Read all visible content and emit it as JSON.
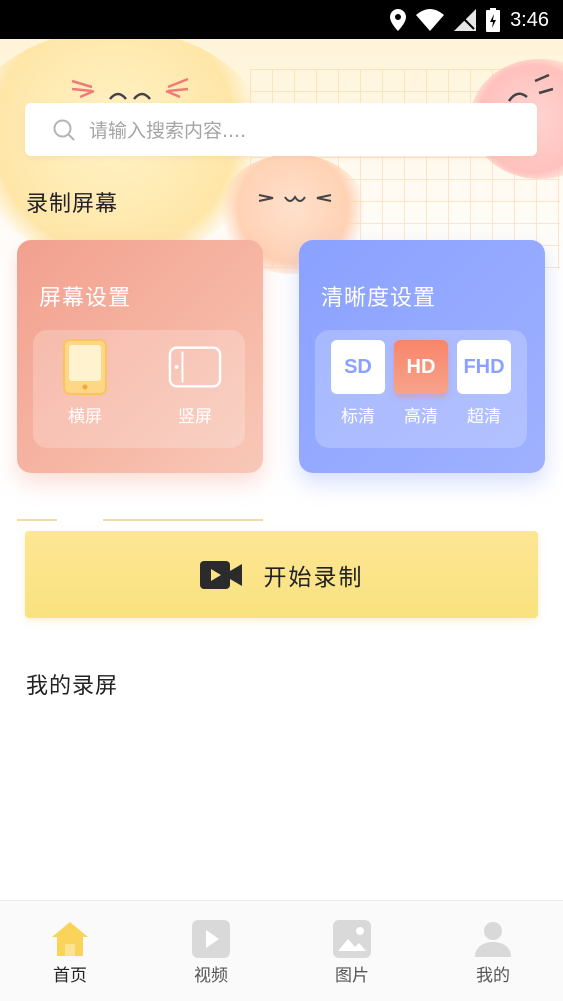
{
  "status": {
    "time": "3:46"
  },
  "search": {
    "placeholder": "请输入搜索内容...."
  },
  "sections": {
    "record": "录制屏幕",
    "my_recordings": "我的录屏"
  },
  "screen_card": {
    "title": "屏幕设置",
    "options": [
      {
        "label": "横屏",
        "icon": "phone-portrait-icon",
        "selected": true
      },
      {
        "label": "竖屏",
        "icon": "phone-landscape-icon",
        "selected": false
      }
    ]
  },
  "quality_card": {
    "title": "清晰度设置",
    "options": [
      {
        "badge": "SD",
        "label": "标清",
        "selected": false
      },
      {
        "badge": "HD",
        "label": "高清",
        "selected": true
      },
      {
        "badge": "FHD",
        "label": "超清",
        "selected": false
      }
    ]
  },
  "record_button": {
    "label": "开始录制",
    "icon": "video-camera-icon"
  },
  "nav": [
    {
      "label": "首页",
      "icon": "home-icon",
      "active": true
    },
    {
      "label": "视频",
      "icon": "video-icon",
      "active": false
    },
    {
      "label": "图片",
      "icon": "image-icon",
      "active": false
    },
    {
      "label": "我的",
      "icon": "user-icon",
      "active": false
    }
  ],
  "colors": {
    "accent_yellow": "#fae383",
    "card_screen": "#f2a08e",
    "card_quality": "#8aa1ff",
    "hd_active": "#f8856a"
  }
}
